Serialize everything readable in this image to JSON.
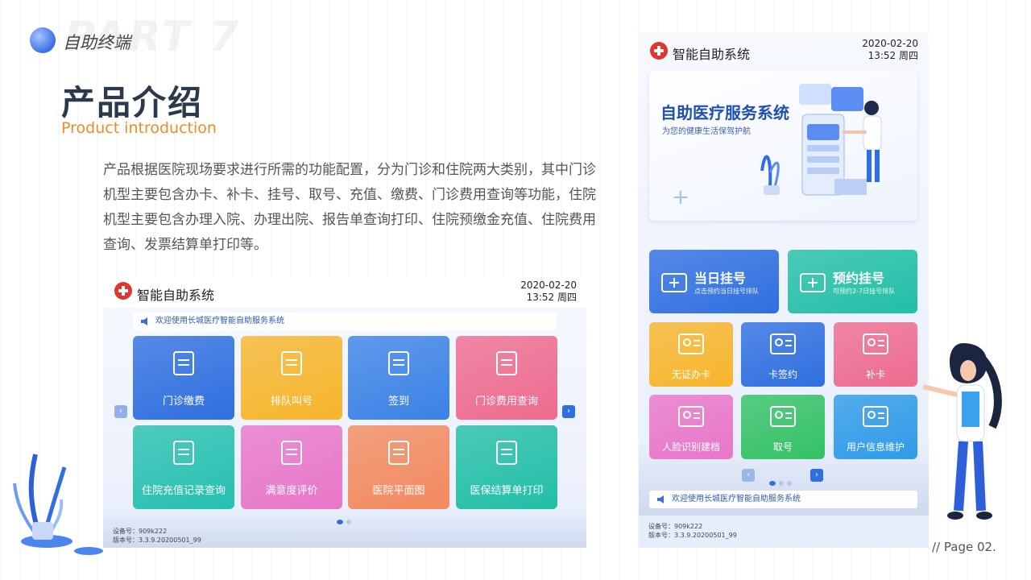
{
  "header": {
    "section": "自助终端",
    "watermark": "PART 7",
    "title": "产品介绍",
    "subtitle": "Product introduction",
    "intro": "产品根据医院现场要求进行所需的功能配置，分为门诊和住院两大类别，其中门诊机型主要包含办卡、补卡、挂号、取号、充值、缴费、门诊费用查询等功能，住院机型主要包含办理入院、办理出院、报告单查询打印、住院预缴金充值、住院费用查询、发票结算单打印等。"
  },
  "kiosk_landscape": {
    "brand": "智能自助系统",
    "date": "2020-02-20",
    "time": "13:52  周四",
    "banner": "欢迎使用长城医疗智能自助服务系统",
    "tiles": [
      {
        "label": "门诊缴费",
        "color": "#2f6fe0",
        "icon": "receipt-icon"
      },
      {
        "label": "排队叫号",
        "color": "#f7b52b",
        "icon": "queue-icon"
      },
      {
        "label": "签到",
        "color": "#3b82e6",
        "icon": "hand-tap-icon"
      },
      {
        "label": "门诊费用查询",
        "color": "#ee6b8f",
        "icon": "document-search-icon"
      },
      {
        "label": "住院充值记录查询",
        "color": "#26c0b0",
        "icon": "yuan-search-icon"
      },
      {
        "label": "满意度评价",
        "color": "#e976c9",
        "icon": "smile-doc-icon"
      },
      {
        "label": "医院平面图",
        "color": "#f38a5e",
        "icon": "map-pin-icon"
      },
      {
        "label": "医保结算单打印",
        "color": "#22bfa5",
        "icon": "printer-icon"
      }
    ],
    "device_no": "设备号：909k222",
    "version": "版本号：3.3.9.20200501_99"
  },
  "kiosk_portrait": {
    "brand": "智能自助系统",
    "date": "2020-02-20",
    "time": "13:52  周四",
    "hero_title": "自助医疗服务系统",
    "hero_sub": "为您的健康生活保驾护航",
    "big_tiles": [
      {
        "title": "当日挂号",
        "sub": "点击预约当日挂号排队",
        "color": "#2f6fe0",
        "icon": "medkit-icon"
      },
      {
        "title": "预约挂号",
        "sub": "可预约2-7日挂号排队",
        "color": "#22bfa5",
        "icon": "calendar-icon"
      }
    ],
    "tiles": [
      {
        "label": "无证办卡",
        "color": "#f7b52b",
        "icon": "id-card-icon"
      },
      {
        "label": "卡签约",
        "color": "#2f6fe0",
        "icon": "card-check-icon"
      },
      {
        "label": "补卡",
        "color": "#ee6b8f",
        "icon": "card-add-icon"
      },
      {
        "label": "人脸识别建档",
        "color": "#e976c9",
        "icon": "face-scan-icon"
      },
      {
        "label": "取号",
        "color": "#34c265",
        "icon": "clock-number-icon"
      },
      {
        "label": "用户信息维护",
        "color": "#2f9be8",
        "icon": "user-edit-icon"
      }
    ],
    "banner": "欢迎使用长城医疗智能自助服务系统",
    "device_no": "设备号：909k222",
    "version": "版本号：3.3.9.20200501_99"
  },
  "page_number": "//  Page 02."
}
